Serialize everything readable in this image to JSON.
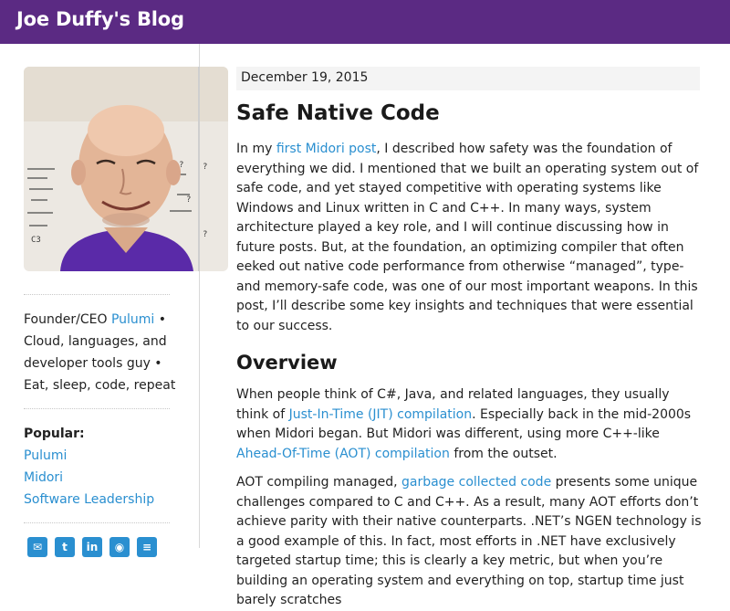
{
  "header": {
    "site_title": "Joe Duffy's Blog",
    "bg_color": "#5b2a83"
  },
  "sidebar": {
    "avatar_alt": "Joe Duffy",
    "bio": {
      "role": "Founder/CEO ",
      "company": "Pulumi",
      "bullet1": " • Cloud, languages, and developer tools guy • Eat, sleep, code, repeat"
    },
    "popular": {
      "heading": "Popular:",
      "links": [
        "Pulumi",
        "Midori",
        "Software Leadership"
      ]
    },
    "social_icons": [
      "email-icon",
      "twitter-icon",
      "linkedin-icon",
      "rss-icon",
      "menu-icon"
    ]
  },
  "post": {
    "date": "December 19, 2015",
    "title": "Safe Native Code",
    "p1": {
      "pre": "In my ",
      "link": "first Midori post",
      "post": ", I described how safety was the foundation of everything we did. I mentioned that we built an operating system out of safe code, and yet stayed competitive with operating systems like Windows and Linux written in C and C++. In many ways, system architecture played a key role, and I will continue discussing how in future posts. But, at the foundation, an optimizing compiler that often eeked out native code performance from otherwise “managed”, type- and memory-safe code, was one of our most important weapons. In this post, I’ll describe some key insights and techniques that were essential to our success."
    },
    "section_overview": "Overview",
    "p2": {
      "pre": "When people think of C#, Java, and related languages, they usually think of ",
      "link1": "Just-In-Time (JIT) compilation",
      "mid": ". Especially back in the mid-2000s when Midori began. But Midori was different, using more C++-like ",
      "link2": "Ahead-Of-Time (AOT) compilation",
      "post": " from the outset."
    },
    "p3": {
      "pre": "AOT compiling managed, ",
      "link": "garbage collected code",
      "post": " presents some unique challenges compared to C and C++. As a result, many AOT efforts don’t achieve parity with their native counterparts. .NET’s NGEN technology is a good example of this. In fact, most efforts in .NET have exclusively targeted startup time; this is clearly a key metric, but when you’re building an operating system and everything on top, startup time just barely scratches"
    },
    "link_color": "#2a8fd0"
  }
}
